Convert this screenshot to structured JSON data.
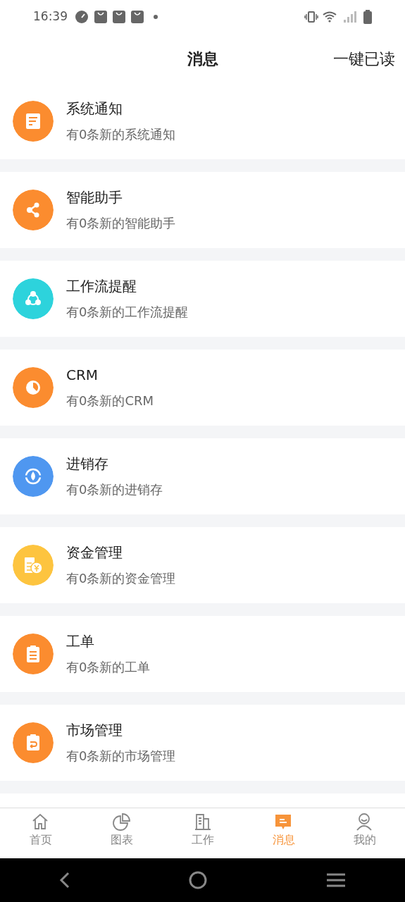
{
  "status_bar": {
    "time": "16:39"
  },
  "header": {
    "title": "消息",
    "action": "一键已读"
  },
  "messages": [
    {
      "title": "系统通知",
      "subtitle": "有0条新的系统通知",
      "color": "#fb8c2f",
      "kind": "document"
    },
    {
      "title": "智能助手",
      "subtitle": "有0条新的智能助手",
      "color": "#fb8c2f",
      "kind": "share"
    },
    {
      "title": "工作流提醒",
      "subtitle": "有0条新的工作流提醒",
      "color": "#2dd3dc",
      "kind": "cycle"
    },
    {
      "title": "CRM",
      "subtitle": "有0条新的CRM",
      "color": "#fb8c2f",
      "kind": "pie"
    },
    {
      "title": "进销存",
      "subtitle": "有0条新的进销存",
      "color": "#4f97f0",
      "kind": "drop"
    },
    {
      "title": "资金管理",
      "subtitle": "有0条新的资金管理",
      "color": "#fdc43f",
      "kind": "money"
    },
    {
      "title": "工单",
      "subtitle": "有0条新的工单",
      "color": "#fb8c2f",
      "kind": "clipboard"
    },
    {
      "title": "市场管理",
      "subtitle": "有0条新的市场管理",
      "color": "#fb8c2f",
      "kind": "return"
    }
  ],
  "tabs": [
    {
      "label": "首页",
      "kind": "home",
      "selected": false
    },
    {
      "label": "图表",
      "kind": "chart",
      "selected": false
    },
    {
      "label": "工作",
      "kind": "building",
      "selected": false
    },
    {
      "label": "消息",
      "kind": "message",
      "selected": true
    },
    {
      "label": "我的",
      "kind": "person",
      "selected": false
    }
  ]
}
